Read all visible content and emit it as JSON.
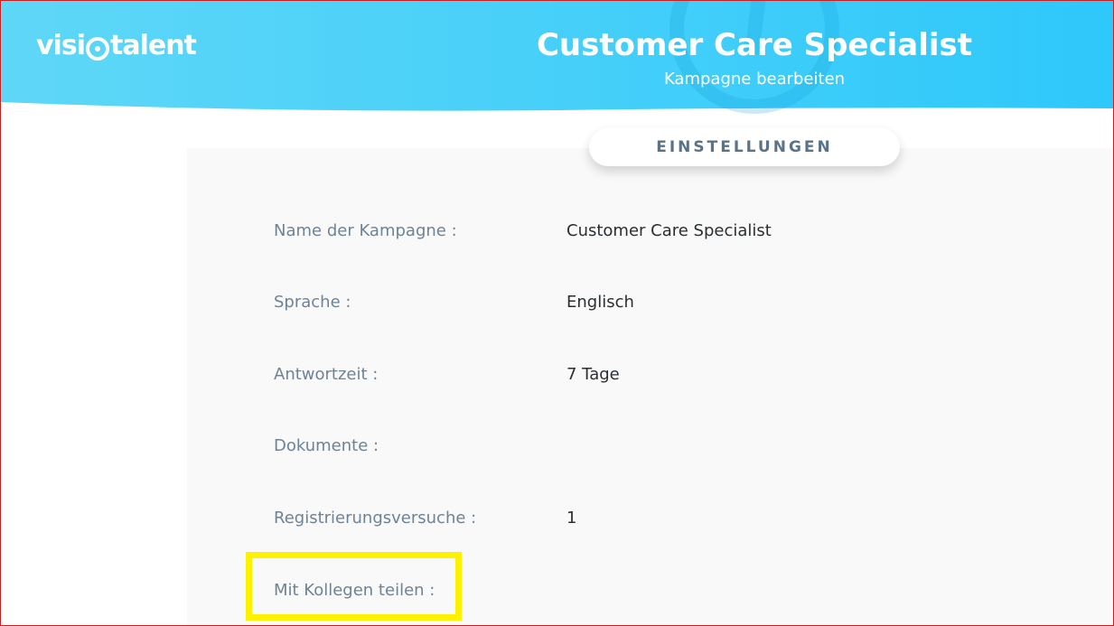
{
  "header": {
    "logo_text_before": "visi",
    "logo_text_after": "talent",
    "title": "Customer Care Specialist",
    "subtitle": "Kampagne bearbeiten"
  },
  "tab": {
    "label": "EINSTELLUNGEN"
  },
  "settings": {
    "rows": [
      {
        "label": "Name der Kampagne :",
        "value": "Customer Care Specialist"
      },
      {
        "label": "Sprache :",
        "value": "Englisch"
      },
      {
        "label": "Antwortzeit :",
        "value": "7 Tage"
      },
      {
        "label": "Dokumente :",
        "value": ""
      },
      {
        "label": "Registrierungsversuche :",
        "value": "1"
      },
      {
        "label": "Mit Kollegen teilen :",
        "value": ""
      }
    ]
  },
  "colors": {
    "header_gradient_start": "#5fd7f7",
    "header_gradient_end": "#2ec8fb",
    "highlight": "#fff200"
  }
}
